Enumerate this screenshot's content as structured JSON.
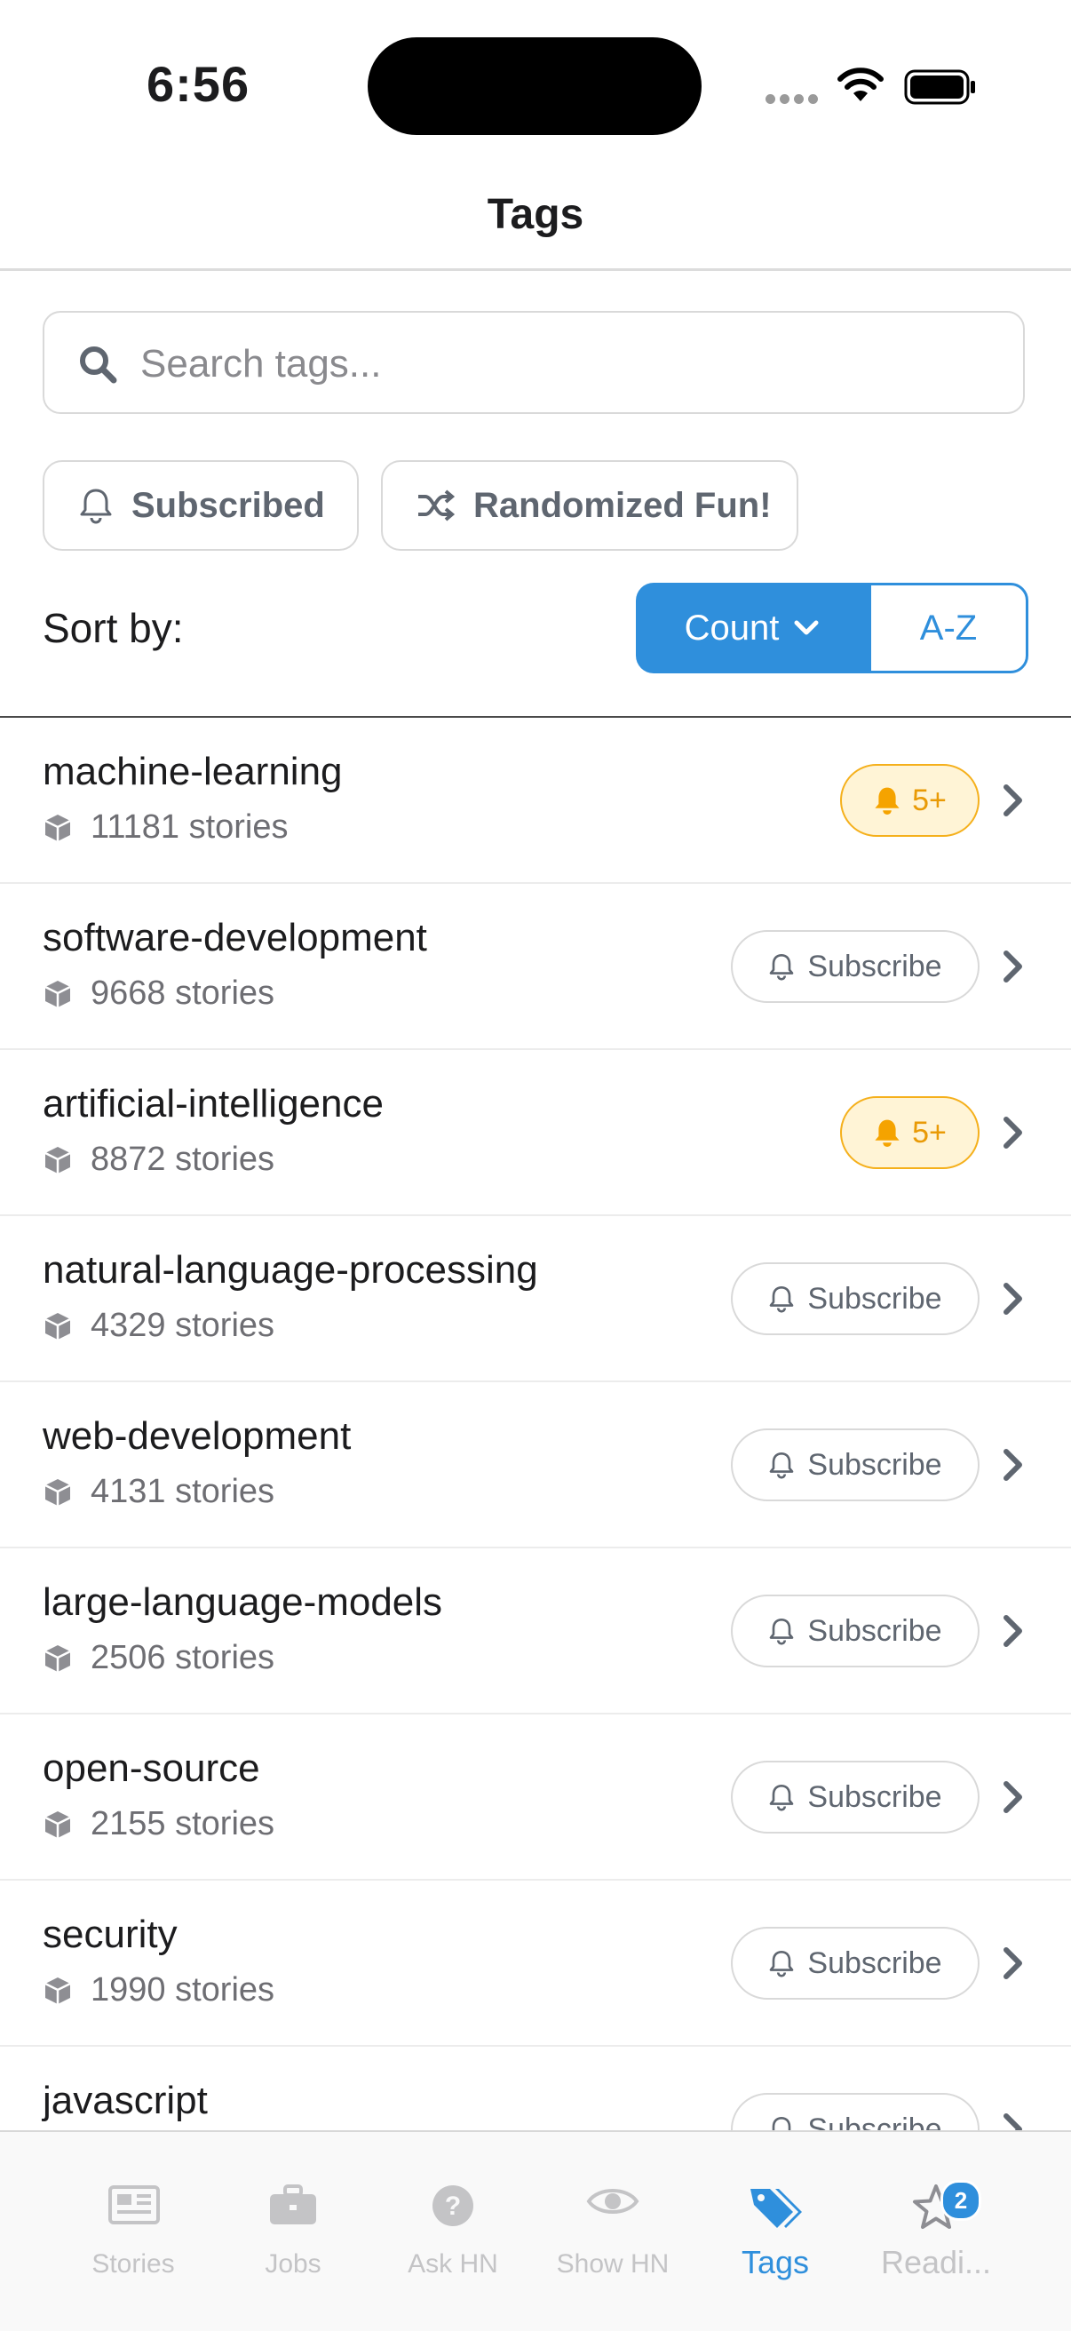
{
  "status_bar": {
    "time": "6:56"
  },
  "nav": {
    "title": "Tags"
  },
  "search": {
    "placeholder": "Search tags..."
  },
  "filters": {
    "subscribed": "Subscribed",
    "randomized": "Randomized Fun!"
  },
  "sort": {
    "label": "Sort by:",
    "options": [
      "Count",
      "A-Z"
    ],
    "selected": "Count"
  },
  "tags": [
    {
      "name": "machine-learning",
      "count": "11181 stories",
      "subscribed": true,
      "badge": "5+"
    },
    {
      "name": "software-development",
      "count": "9668 stories",
      "subscribed": false,
      "button": "Subscribe"
    },
    {
      "name": "artificial-intelligence",
      "count": "8872 stories",
      "subscribed": true,
      "badge": "5+"
    },
    {
      "name": "natural-language-processing",
      "count": "4329 stories",
      "subscribed": false,
      "button": "Subscribe"
    },
    {
      "name": "web-development",
      "count": "4131 stories",
      "subscribed": false,
      "button": "Subscribe"
    },
    {
      "name": "large-language-models",
      "count": "2506 stories",
      "subscribed": false,
      "button": "Subscribe"
    },
    {
      "name": "open-source",
      "count": "2155 stories",
      "subscribed": false,
      "button": "Subscribe"
    },
    {
      "name": "security",
      "count": "1990 stories",
      "subscribed": false,
      "button": "Subscribe"
    },
    {
      "name": "javascript",
      "count": "",
      "subscribed": false,
      "button": "Subscribe"
    }
  ],
  "tab_bar": {
    "tabs": [
      {
        "label": "Stories",
        "icon": "newspaper-icon",
        "active": false
      },
      {
        "label": "Jobs",
        "icon": "briefcase-icon",
        "active": false
      },
      {
        "label": "Ask HN",
        "icon": "question-icon",
        "active": false
      },
      {
        "label": "Show HN",
        "icon": "eye-icon",
        "active": false
      },
      {
        "label": "Tags",
        "icon": "tags-icon",
        "active": true
      },
      {
        "label": "Readi...",
        "icon": "star-icon",
        "active": false,
        "badge": "2"
      }
    ]
  },
  "colors": {
    "accent": "#2f8fdc",
    "subscribed_bg": "#fff4d6",
    "subscribed_fg": "#e99a06",
    "muted": "#6e6e73"
  }
}
